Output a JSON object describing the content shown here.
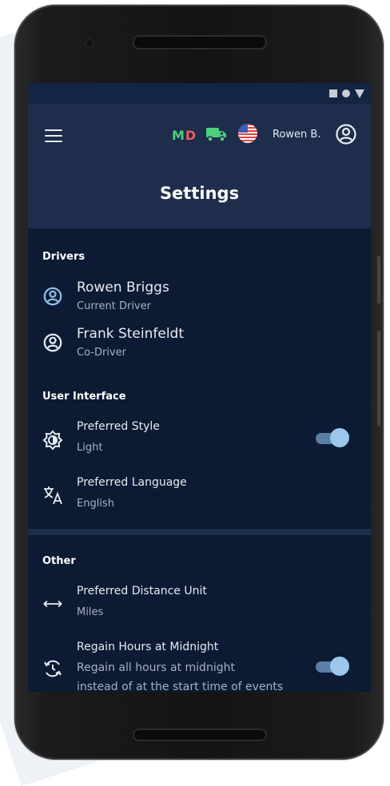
{
  "header": {
    "badge_m": "M",
    "badge_d": "D",
    "user_name": "Rowen B.",
    "title": "Settings"
  },
  "sections": {
    "drivers": {
      "title": "Drivers",
      "current": {
        "name": "Rowen Briggs",
        "role": "Current Driver"
      },
      "co": {
        "name": "Frank Steinfeldt",
        "role": "Co-Driver"
      }
    },
    "ui": {
      "title": "User Interface",
      "style": {
        "label": "Preferred Style",
        "value": "Light",
        "enabled": true
      },
      "language": {
        "label": "Preferred Language",
        "value": "English"
      }
    },
    "other": {
      "title": "Other",
      "distance": {
        "label": "Preferred Distance Unit",
        "value": "Miles"
      },
      "regain": {
        "label": "Regain Hours at Midnight",
        "desc1": "Regain all hours at midnight",
        "desc2": "instead of at the start time of events",
        "enabled": true
      }
    }
  },
  "icons": {
    "menu": "menu-icon",
    "truck": "truck-icon",
    "flag": "us-flag-icon",
    "account": "account-circle-icon",
    "style": "brightness-icon",
    "language": "translate-icon",
    "distance": "arrows-horizontal-icon",
    "regain": "rotate-clock-icon"
  },
  "colors": {
    "screen_bg": "#0c1a33",
    "appbar_bg": "#1d2d4b",
    "accent": "#9cc6ec",
    "badge_m": "#4cd07d",
    "badge_d": "#f05b5b"
  }
}
